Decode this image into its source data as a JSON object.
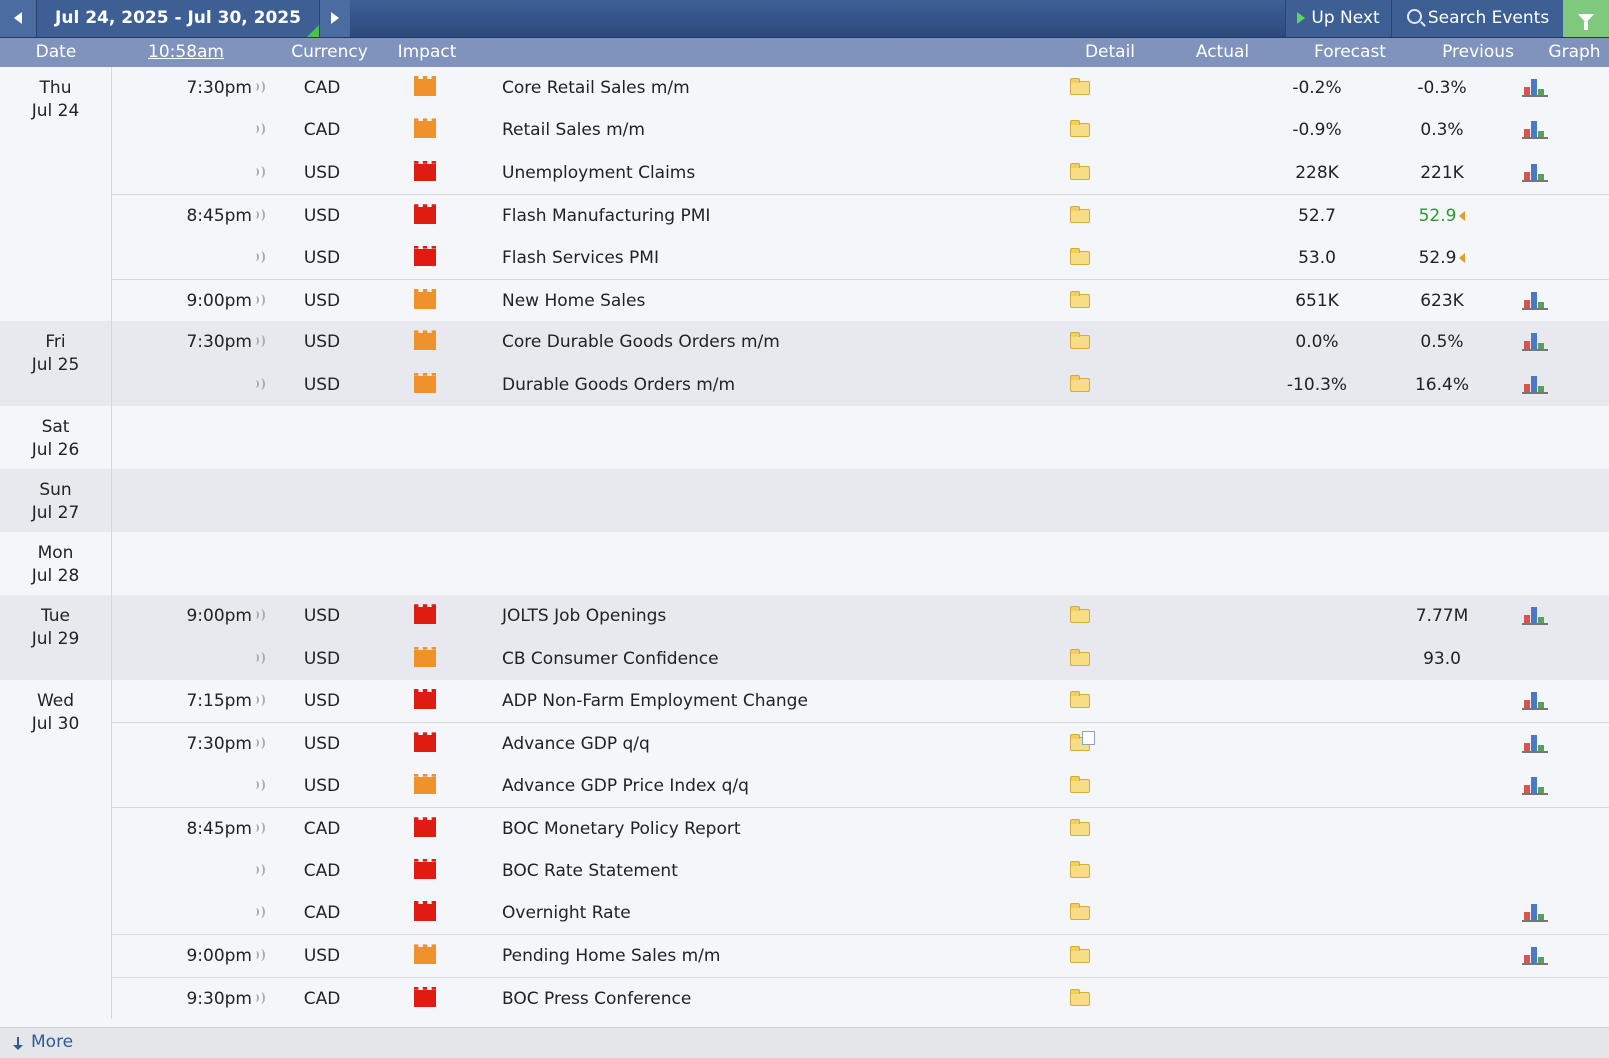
{
  "topbar": {
    "range": "Jul 24, 2025 - Jul 30, 2025",
    "up_next": "Up Next",
    "search": "Search Events"
  },
  "headers": {
    "date": "Date",
    "time": "10:58am",
    "currency": "Currency",
    "impact": "Impact",
    "detail": "Detail",
    "actual": "Actual",
    "forecast": "Forecast",
    "previous": "Previous",
    "graph": "Graph"
  },
  "days": [
    {
      "dow": "Thu",
      "date": "Jul 24",
      "events": [
        {
          "time": "7:30pm",
          "cur": "CAD",
          "impact": "medium",
          "title": "Core Retail Sales m/m",
          "forecast": "-0.2%",
          "previous": "-0.3%",
          "graph": true
        },
        {
          "time": "",
          "cur": "CAD",
          "impact": "medium",
          "title": "Retail Sales m/m",
          "forecast": "-0.9%",
          "previous": "0.3%",
          "graph": true
        },
        {
          "time": "",
          "cur": "USD",
          "impact": "high",
          "title": "Unemployment Claims",
          "forecast": "228K",
          "previous": "221K",
          "graph": true
        },
        {
          "time": "8:45pm",
          "cur": "USD",
          "impact": "high",
          "title": "Flash Manufacturing PMI",
          "forecast": "52.7",
          "previous": "52.9",
          "previous_status": "better",
          "revised": true,
          "graph": false
        },
        {
          "time": "",
          "cur": "USD",
          "impact": "high",
          "title": "Flash Services PMI",
          "forecast": "53.0",
          "previous": "52.9",
          "revised": true,
          "graph": false
        },
        {
          "time": "9:00pm",
          "cur": "USD",
          "impact": "medium",
          "title": "New Home Sales",
          "forecast": "651K",
          "previous": "623K",
          "graph": true
        }
      ]
    },
    {
      "dow": "Fri",
      "date": "Jul 25",
      "events": [
        {
          "time": "7:30pm",
          "cur": "USD",
          "impact": "medium",
          "title": "Core Durable Goods Orders m/m",
          "forecast": "0.0%",
          "previous": "0.5%",
          "graph": true
        },
        {
          "time": "",
          "cur": "USD",
          "impact": "medium",
          "title": "Durable Goods Orders m/m",
          "forecast": "-10.3%",
          "previous": "16.4%",
          "graph": true
        }
      ]
    },
    {
      "dow": "Sat",
      "date": "Jul 26",
      "events": []
    },
    {
      "dow": "Sun",
      "date": "Jul 27",
      "events": []
    },
    {
      "dow": "Mon",
      "date": "Jul 28",
      "events": []
    },
    {
      "dow": "Tue",
      "date": "Jul 29",
      "events": [
        {
          "time": "9:00pm",
          "cur": "USD",
          "impact": "high",
          "title": "JOLTS Job Openings",
          "forecast": "",
          "previous": "7.77M",
          "graph": true
        },
        {
          "time": "",
          "cur": "USD",
          "impact": "medium",
          "title": "CB Consumer Confidence",
          "forecast": "",
          "previous": "93.0",
          "graph": false
        }
      ]
    },
    {
      "dow": "Wed",
      "date": "Jul 30",
      "events": [
        {
          "time": "7:15pm",
          "cur": "USD",
          "impact": "high",
          "title": "ADP Non-Farm Employment Change",
          "forecast": "",
          "previous": "",
          "graph": true
        },
        {
          "time": "7:30pm",
          "cur": "USD",
          "impact": "high",
          "title": "Advance GDP q/q",
          "forecast": "",
          "previous": "",
          "graph": true,
          "detail_doc": true
        },
        {
          "time": "",
          "cur": "USD",
          "impact": "medium",
          "title": "Advance GDP Price Index q/q",
          "forecast": "",
          "previous": "",
          "graph": true
        },
        {
          "time": "8:45pm",
          "cur": "CAD",
          "impact": "high",
          "title": "BOC Monetary Policy Report",
          "forecast": "",
          "previous": "",
          "graph": false
        },
        {
          "time": "",
          "cur": "CAD",
          "impact": "high",
          "title": "BOC Rate Statement",
          "forecast": "",
          "previous": "",
          "graph": false
        },
        {
          "time": "",
          "cur": "CAD",
          "impact": "high",
          "title": "Overnight Rate",
          "forecast": "",
          "previous": "",
          "graph": true
        },
        {
          "time": "9:00pm",
          "cur": "USD",
          "impact": "medium",
          "title": "Pending Home Sales m/m",
          "forecast": "",
          "previous": "",
          "graph": true
        },
        {
          "time": "9:30pm",
          "cur": "CAD",
          "impact": "high",
          "title": "BOC Press Conference",
          "forecast": "",
          "previous": "",
          "graph": false
        }
      ]
    }
  ],
  "footer": {
    "more": "More"
  },
  "colors": {
    "high_impact": "#e01b12",
    "medium_impact": "#f0922a",
    "better": "#2a9a2a",
    "header_bg": "#7f93bd",
    "topbar_bg": "#2c4a7c"
  }
}
